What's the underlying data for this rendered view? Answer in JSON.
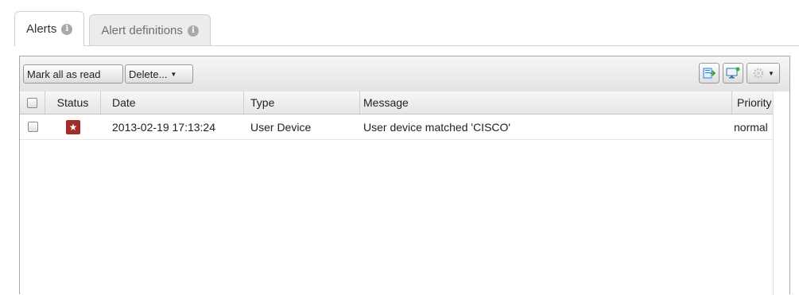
{
  "tabs": [
    {
      "label": "Alerts",
      "active": true
    },
    {
      "label": "Alert definitions",
      "active": false
    }
  ],
  "toolbar": {
    "mark_all_read_label": "Mark all as read",
    "delete_label": "Delete...",
    "icons": [
      "export-icon",
      "monitor-icon",
      "gear-icon"
    ]
  },
  "table": {
    "columns": [
      "Status",
      "Date",
      "Type",
      "Message",
      "Priority"
    ],
    "rows": [
      {
        "status_icon": "star-icon",
        "date": "2013-02-19 17:13:24",
        "type": "User Device",
        "message": "User device matched 'CISCO'",
        "priority": "normal"
      }
    ]
  },
  "colors": {
    "status_alert": "#a52a2a",
    "toolbar_bg": "#e8e8e8"
  }
}
